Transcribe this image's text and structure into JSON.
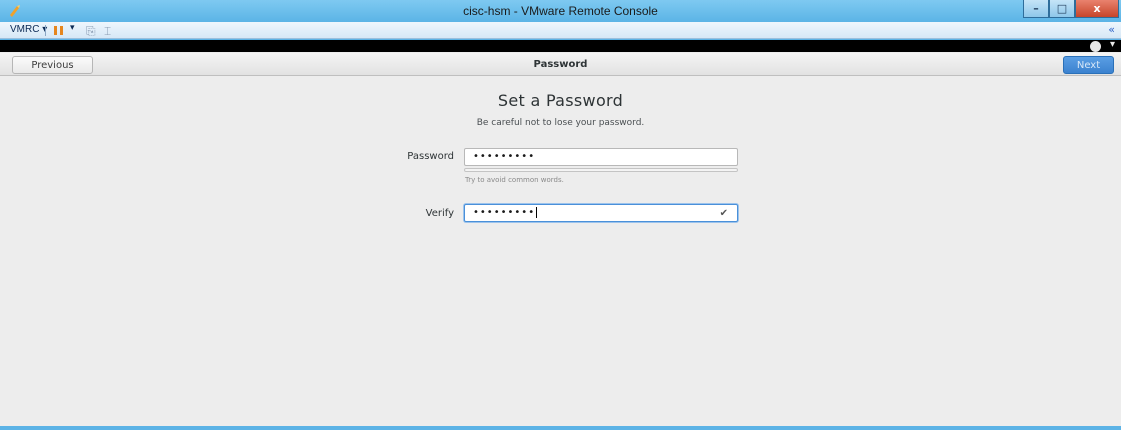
{
  "window": {
    "title": "cisc-hsm - VMware Remote Console",
    "buttons": {
      "minimize": "–",
      "maximize": "□",
      "close": "x"
    }
  },
  "toolbar": {
    "menu_label": "VMRC ▾",
    "pause_caret": "▾",
    "send_keys_glyph": "⎘",
    "fullscreen_glyph": "⌶",
    "collapse_glyph": "«"
  },
  "topbar": {
    "a11y_caret": "▾"
  },
  "header": {
    "previous_label": "Previous",
    "title": "Password",
    "next_label": "Next"
  },
  "page": {
    "title": "Set a Password",
    "subtitle": "Be careful not to lose your password."
  },
  "form": {
    "password_label": "Password",
    "password_value": "•••••••••",
    "strength_fraction": 0.0,
    "hint": "Try to avoid common words.",
    "verify_label": "Verify",
    "verify_value": "•••••••••",
    "verify_check": "✔"
  },
  "colors": {
    "frame": "#5cb3e6",
    "guest_bg": "#ededed",
    "accent": "#3b82cf"
  }
}
